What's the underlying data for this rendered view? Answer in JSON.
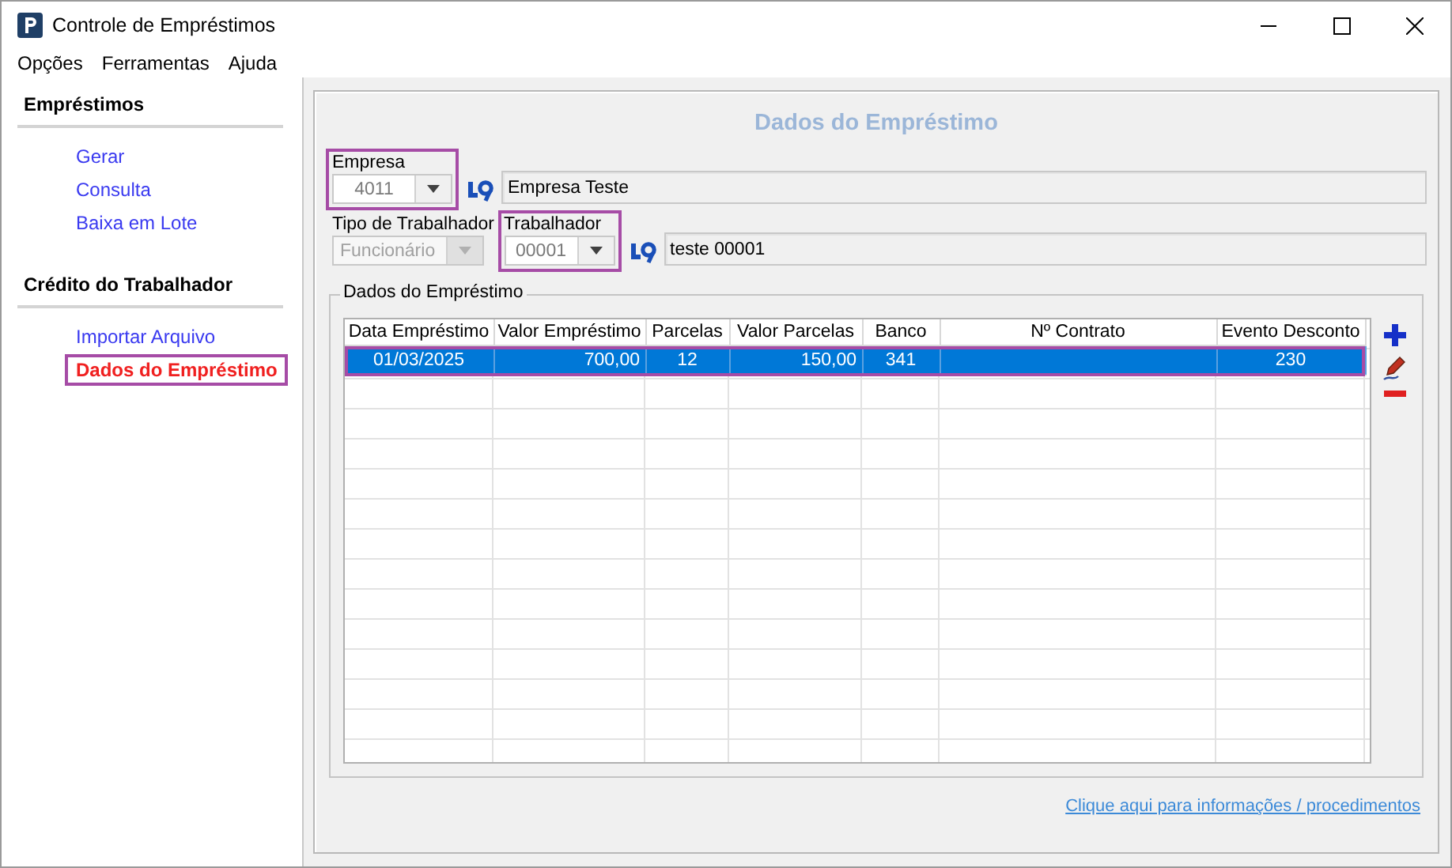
{
  "window": {
    "title": "Controle de Empréstimos"
  },
  "menu": [
    "Opções",
    "Ferramentas",
    "Ajuda"
  ],
  "sidebar": {
    "sections": [
      {
        "title": "Empréstimos",
        "items": [
          {
            "label": "Gerar",
            "selected": false,
            "highlighted": false
          },
          {
            "label": "Consulta",
            "selected": false,
            "highlighted": false
          },
          {
            "label": "Baixa em Lote",
            "selected": false,
            "highlighted": false
          }
        ]
      },
      {
        "title": "Crédito do Trabalhador",
        "items": [
          {
            "label": "Importar Arquivo",
            "selected": false,
            "highlighted": false
          },
          {
            "label": "Dados do Empréstimo",
            "selected": true,
            "highlighted": true
          }
        ]
      }
    ]
  },
  "form": {
    "heading": "Dados do Empréstimo",
    "empresa": {
      "label": "Empresa",
      "value": "4011",
      "highlighted": true,
      "name": "Empresa Teste"
    },
    "tipo": {
      "label": "Tipo de Trabalhador",
      "value": "Funcionário",
      "disabled": true
    },
    "trabalhador": {
      "label": "Trabalhador",
      "value": "00001",
      "highlighted": true,
      "name": "teste 00001"
    },
    "group_title": "Dados do Empréstimo",
    "table": {
      "columns": [
        "Data Empréstimo",
        "Valor Empréstimo",
        "Parcelas",
        "Valor Parcelas",
        "Banco",
        "Nº Contrato",
        "Evento Desconto"
      ],
      "rows": [
        {
          "selected": true,
          "highlighted": true,
          "cells": [
            "01/03/2025",
            "700,00",
            "12",
            "150,00",
            "341",
            null,
            "230"
          ]
        }
      ]
    },
    "link": "Clique aqui para informações / procedimentos"
  }
}
